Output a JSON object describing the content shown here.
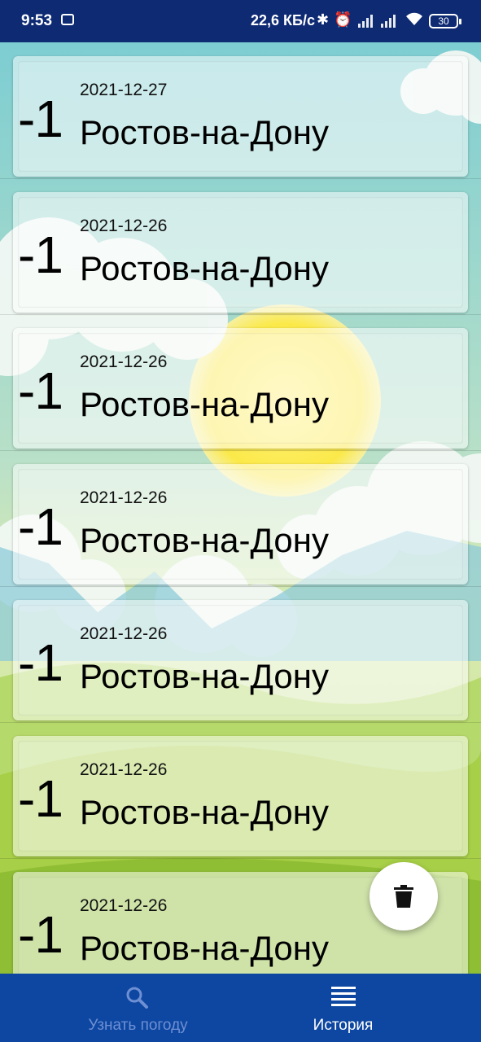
{
  "status_bar": {
    "time": "9:53",
    "net_speed": "22,6 КБ/с",
    "battery": "30",
    "icons": [
      "notification-icon",
      "bluetooth-icon",
      "alarm-icon",
      "signal-icon",
      "signal-icon",
      "wifi-icon",
      "battery-icon"
    ]
  },
  "history": {
    "items": [
      {
        "temp": "-1",
        "date": "2021-12-27",
        "city": "Ростов-на-Дону"
      },
      {
        "temp": "-1",
        "date": "2021-12-26",
        "city": "Ростов-на-Дону"
      },
      {
        "temp": "-1",
        "date": "2021-12-26",
        "city": "Ростов-на-Дону"
      },
      {
        "temp": "-1",
        "date": "2021-12-26",
        "city": "Ростов-на-Дону"
      },
      {
        "temp": "-1",
        "date": "2021-12-26",
        "city": "Ростов-на-Дону"
      },
      {
        "temp": "-1",
        "date": "2021-12-26",
        "city": "Ростов-на-Дону"
      },
      {
        "temp": "-1",
        "date": "2021-12-26",
        "city": "Ростов-на-Дону"
      }
    ]
  },
  "fab": {
    "icon": "trash-icon"
  },
  "bottom_nav": {
    "items": [
      {
        "label": "Узнать погоду",
        "icon": "search-icon",
        "active": false
      },
      {
        "label": "История",
        "icon": "list-icon",
        "active": true
      }
    ]
  },
  "colors": {
    "status_bar": "#0d2a73",
    "bottom_nav": "#0d47a1",
    "nav_active": "#ffffff",
    "nav_inactive": "#6f8fd3"
  }
}
